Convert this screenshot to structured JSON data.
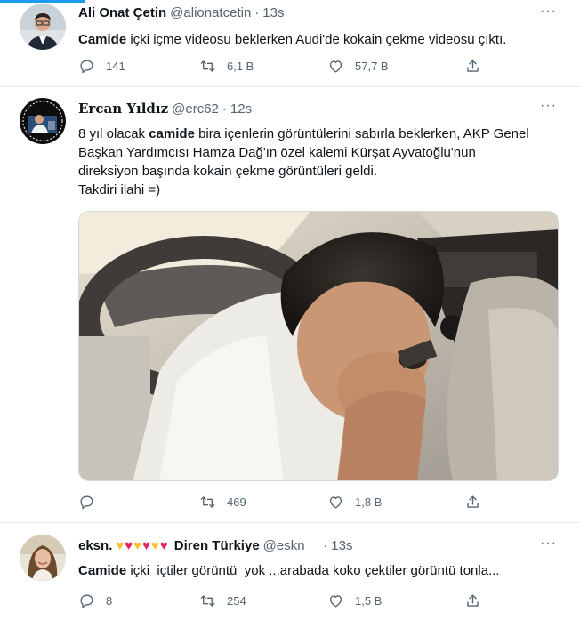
{
  "tweets": [
    {
      "name": "Ali Onat Çetin",
      "handle": "@alionatcetin",
      "time": "13s",
      "text_bold": "Camide",
      "text_rest": " içki içme videosu beklerken Audi'de kokain çekme videosu çıktı.",
      "replies": "141",
      "retweets": "6,1 B",
      "likes": "57,7 B"
    },
    {
      "name": "Ercan Yıldız",
      "handle": "@erc62",
      "time": "12s",
      "line1_pre": "8 yıl olacak ",
      "line1_bold": "camide",
      "line1_post": " bira içenlerin görüntülerini sabırla beklerken, AKP Genel",
      "line2": "Başkan Yardımcısı Hamza Dağ'ın özel kalemi Kürşat Ayvatoğlu'nun",
      "line3": "direksiyon başında kokain çekme görüntüleri geldi.",
      "line4": "Takdiri ilahi =)",
      "replies": "",
      "retweets": "469",
      "likes": "1,8 B"
    },
    {
      "name": "eksn.",
      "name_suffix": "Diren Türkiye",
      "handle": "@eskn__",
      "time": "13s",
      "text_bold": "Camide",
      "text_rest": " içki  içtiler görüntü  yok ...arabada koko çektiler görüntü tonla...",
      "replies": "8",
      "retweets": "254",
      "likes": "1,5 B"
    }
  ],
  "colors": {
    "accent": "#1d9bf0",
    "secondary_text": "#536471",
    "heart_yellow": "#f4c430",
    "heart_red": "#e0245e"
  },
  "icons": {
    "reply": "reply-icon",
    "retweet": "retweet-icon",
    "like": "like-icon",
    "share": "share-icon",
    "more": "more-icon"
  },
  "separator": "·",
  "more_glyph": "···"
}
